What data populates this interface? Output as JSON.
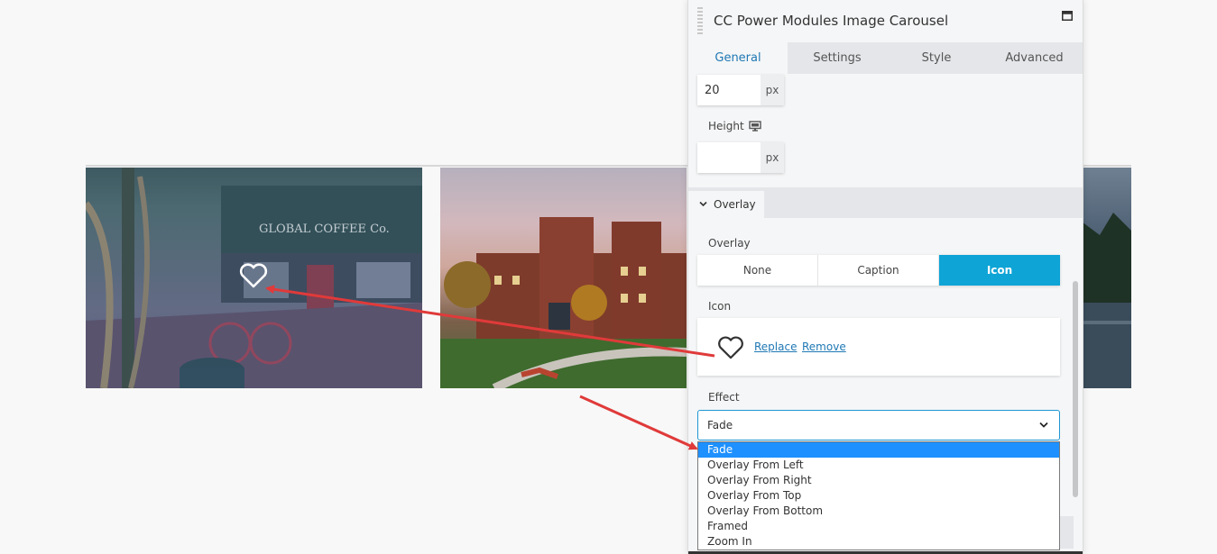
{
  "panel": {
    "title": "CC Power Modules Image Carousel",
    "tabs": [
      {
        "label": "General",
        "active": true
      },
      {
        "label": "Settings",
        "active": false
      },
      {
        "label": "Style",
        "active": false
      },
      {
        "label": "Advanced",
        "active": false
      }
    ]
  },
  "fields": {
    "width_value": "20",
    "width_unit": "px",
    "height_label": "Height",
    "height_value": "",
    "height_unit": "px"
  },
  "overlay_section": {
    "title": "Overlay",
    "overlay_label": "Overlay",
    "options": [
      "None",
      "Caption",
      "Icon"
    ],
    "selected": "Icon",
    "icon_label": "Icon",
    "icon_name": "heart-outline-icon",
    "replace_link": "Replace",
    "remove_link": "Remove",
    "effect_label": "Effect",
    "effect_value": "Fade",
    "effect_options": [
      "Fade",
      "Overlay From Left",
      "Overlay From Right",
      "Overlay From Top",
      "Overlay From Bottom",
      "Framed",
      "Zoom In"
    ]
  },
  "colors": {
    "accent": "#0ea4d6",
    "tab_active_text": "#1f78b4",
    "dropdown_highlight": "#1e90ff",
    "annotation_arrow": "#e03a3a"
  },
  "carousel": {
    "storefront_sign": "GLOBAL COFFEE Co."
  }
}
